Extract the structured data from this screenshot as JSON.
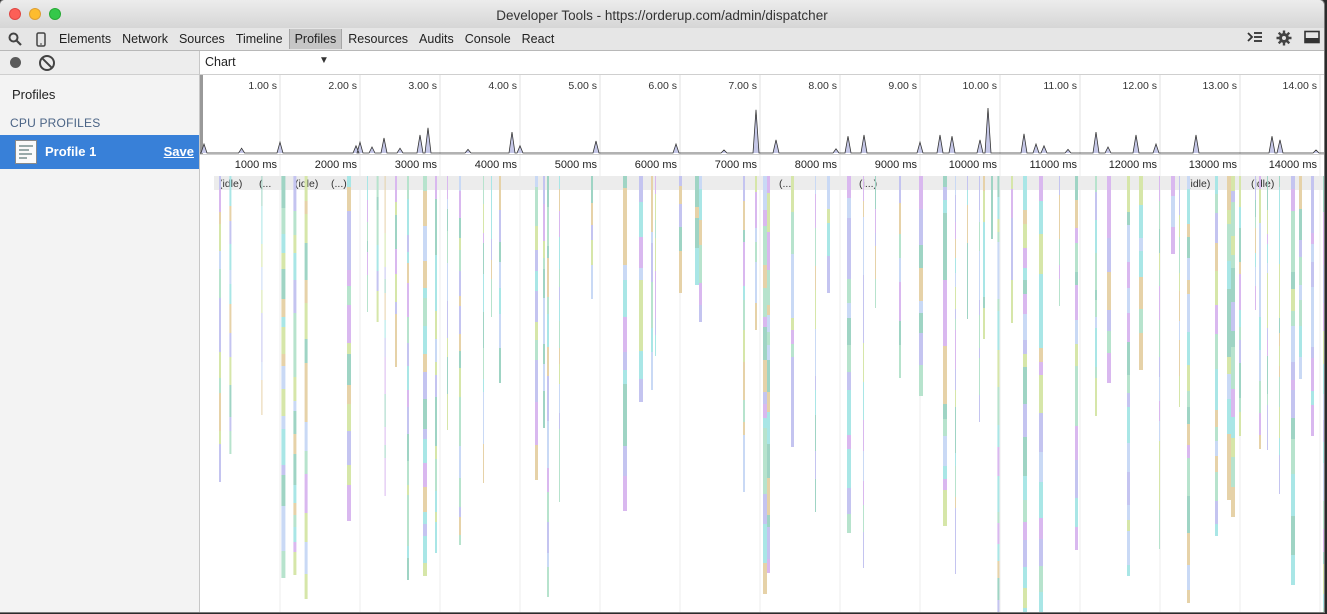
{
  "window": {
    "title": "Developer Tools - https://orderup.com/admin/dispatcher"
  },
  "toolbar": {
    "search_icon": "search-icon",
    "device_icon": "device-mode-icon",
    "tabs": [
      {
        "label": "Elements",
        "active": false
      },
      {
        "label": "Network",
        "active": false
      },
      {
        "label": "Sources",
        "active": false
      },
      {
        "label": "Timeline",
        "active": false
      },
      {
        "label": "Profiles",
        "active": true
      },
      {
        "label": "Resources",
        "active": false
      },
      {
        "label": "Audits",
        "active": false
      },
      {
        "label": "Console",
        "active": false
      },
      {
        "label": "React",
        "active": false
      }
    ],
    "right_icons": [
      "drawer-toggle-icon",
      "settings-gear-icon",
      "dock-side-icon"
    ]
  },
  "sidebar": {
    "title": "Profiles",
    "section": "CPU PROFILES",
    "profile": {
      "name": "Profile 1",
      "save_label": "Save"
    }
  },
  "main": {
    "view_select": "Chart"
  },
  "overview": {
    "second_labels": [
      "1.00 s",
      "2.00 s",
      "3.00 s",
      "4.00 s",
      "5.00 s",
      "6.00 s",
      "7.00 s",
      "8.00 s",
      "9.00 s",
      "10.00 s",
      "11.00 s",
      "12.00 s",
      "13.00 s",
      "14.00 s"
    ],
    "spikes": [
      {
        "t": 0.05,
        "h": 0.15
      },
      {
        "t": 0.52,
        "h": 0.08
      },
      {
        "t": 1.0,
        "h": 0.18
      },
      {
        "t": 1.95,
        "h": 0.12
      },
      {
        "t": 2.0,
        "h": 0.18
      },
      {
        "t": 2.15,
        "h": 0.1
      },
      {
        "t": 2.3,
        "h": 0.25
      },
      {
        "t": 2.5,
        "h": 0.08
      },
      {
        "t": 2.75,
        "h": 0.3
      },
      {
        "t": 2.85,
        "h": 0.42
      },
      {
        "t": 3.35,
        "h": 0.06
      },
      {
        "t": 3.9,
        "h": 0.35
      },
      {
        "t": 4.0,
        "h": 0.12
      },
      {
        "t": 4.95,
        "h": 0.2
      },
      {
        "t": 5.95,
        "h": 0.15
      },
      {
        "t": 6.55,
        "h": 0.05
      },
      {
        "t": 6.95,
        "h": 0.72
      },
      {
        "t": 7.2,
        "h": 0.22
      },
      {
        "t": 7.95,
        "h": 0.07
      },
      {
        "t": 8.1,
        "h": 0.28
      },
      {
        "t": 8.3,
        "h": 0.3
      },
      {
        "t": 9.0,
        "h": 0.18
      },
      {
        "t": 9.25,
        "h": 0.3
      },
      {
        "t": 9.4,
        "h": 0.28
      },
      {
        "t": 9.75,
        "h": 0.22
      },
      {
        "t": 9.85,
        "h": 0.75
      },
      {
        "t": 10.3,
        "h": 0.32
      },
      {
        "t": 10.45,
        "h": 0.15
      },
      {
        "t": 10.55,
        "h": 0.12
      },
      {
        "t": 10.85,
        "h": 0.06
      },
      {
        "t": 11.2,
        "h": 0.35
      },
      {
        "t": 11.35,
        "h": 0.1
      },
      {
        "t": 11.7,
        "h": 0.3
      },
      {
        "t": 11.95,
        "h": 0.15
      },
      {
        "t": 12.45,
        "h": 0.3
      },
      {
        "t": 13.4,
        "h": 0.28
      },
      {
        "t": 13.5,
        "h": 0.22
      },
      {
        "t": 13.95,
        "h": 0.05
      }
    ]
  },
  "timeline": {
    "ms_labels": [
      "1000 ms",
      "2000 ms",
      "3000 ms",
      "4000 ms",
      "5000 ms",
      "6000 ms",
      "7000 ms",
      "8000 ms",
      "9000 ms",
      "10000 ms",
      "11000 ms",
      "12000 ms",
      "13000 ms",
      "14000 ms"
    ],
    "root_labels": [
      {
        "t": 0.2,
        "text": "(idle)"
      },
      {
        "t": 0.7,
        "text": "(..."
      },
      {
        "t": 1.15,
        "text": "(idle)"
      },
      {
        "t": 1.6,
        "text": "(...)"
      },
      {
        "t": 7.2,
        "text": "(..."
      },
      {
        "t": 8.2,
        "text": "(i...)"
      },
      {
        "t": 12.3,
        "text": "(idle)"
      },
      {
        "t": 13.1,
        "text": "(idle)"
      }
    ],
    "activity": [
      0.05,
      0.18,
      0.58,
      0.83,
      0.98,
      1.12,
      1.65,
      1.9,
      2.02,
      2.12,
      2.25,
      2.4,
      2.6,
      2.75,
      2.9,
      3.05,
      3.35,
      3.45,
      3.55,
      4.0,
      4.1,
      4.15,
      4.3,
      4.7,
      5.1,
      5.3,
      5.45,
      5.5,
      5.8,
      6.0,
      6.05,
      6.6,
      6.75,
      6.85,
      6.9,
      7.2,
      7.5,
      7.65,
      7.9,
      8.1,
      8.25,
      8.55,
      8.8,
      9.1,
      9.25,
      9.4,
      9.55,
      9.6,
      9.7,
      9.78,
      9.95,
      10.1,
      10.3,
      10.55,
      10.75,
      11.0,
      11.15,
      11.4,
      11.55,
      11.8,
      11.95,
      12.05,
      12.15,
      12.5,
      12.65,
      12.7,
      12.8,
      13.0,
      13.05,
      13.15,
      13.3,
      13.45,
      13.55,
      13.7,
      13.85,
      13.92
    ]
  },
  "colors": {
    "accent": "#3880d8",
    "overview_fill": "#c6c8e8",
    "flame_palette": [
      "#b7e3cd",
      "#c4c4f0",
      "#a9e6e6",
      "#d6e6a9",
      "#d9b8ef",
      "#9fd4c4",
      "#c9d9f5",
      "#e6d2a8"
    ]
  }
}
